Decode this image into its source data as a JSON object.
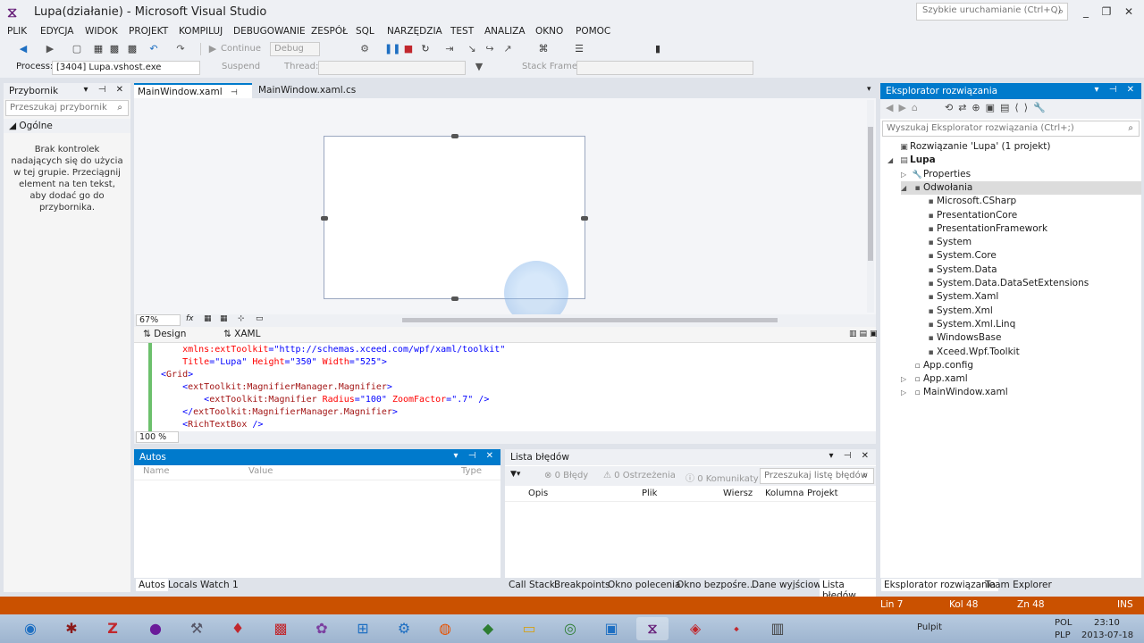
{
  "window": {
    "title": "Lupa(działanie) - Microsoft Visual Studio",
    "quick_launch_placeholder": "Szybkie uruchamianie (Ctrl+Q)",
    "logo_text": "⧖"
  },
  "menu": [
    "PLIK",
    "EDYCJA",
    "WIDOK",
    "PROJEKT",
    "KOMPILUJ",
    "DEBUGOWANIE",
    "ZESPÓŁ",
    "SQL",
    "NARZĘDZIA",
    "TEST",
    "ANALIZA",
    "OKNO",
    "POMOC"
  ],
  "toolbar": {
    "continue_label": "Continue",
    "config_value": "Debug",
    "process_label": "Process:",
    "process_value": "[3404] Lupa.vshost.exe",
    "suspend_label": "Suspend",
    "thread_label": "Thread:",
    "stack_frame_label": "Stack Frame:"
  },
  "toolbox": {
    "title": "Przybornik",
    "search_placeholder": "Przeszukaj przybornik",
    "group": "Ogólne",
    "message": "Brak kontrolek nadających się do użycia w tej grupie. Przeciągnij element na ten tekst, aby dodać go do przybornika."
  },
  "tabs": {
    "main_xaml": "MainWindow.xaml",
    "main_cs": "MainWindow.xaml.cs"
  },
  "designer": {
    "zoom": "67%",
    "tab_design": "Design",
    "tab_xaml": "XAML"
  },
  "code": {
    "zoom": "100 %",
    "lines": [
      {
        "indent": "    ",
        "parts": [
          {
            "t": "xmlns:extToolkit",
            "c": "attr"
          },
          {
            "t": "=",
            "c": "punc"
          },
          {
            "t": "\"http://schemas.xceed.com/wpf/xaml/toolkit\"",
            "c": "val"
          }
        ]
      },
      {
        "indent": "    ",
        "parts": [
          {
            "t": "Title",
            "c": "attr"
          },
          {
            "t": "=",
            "c": "punc"
          },
          {
            "t": "\"Lupa\"",
            "c": "val"
          },
          {
            "t": " Height",
            "c": "attr"
          },
          {
            "t": "=",
            "c": "punc"
          },
          {
            "t": "\"350\"",
            "c": "val"
          },
          {
            "t": " Width",
            "c": "attr"
          },
          {
            "t": "=",
            "c": "punc"
          },
          {
            "t": "\"525\"",
            "c": "val"
          },
          {
            "t": ">",
            "c": "punc"
          }
        ]
      },
      {
        "indent": "",
        "parts": [
          {
            "t": "<",
            "c": "punc"
          },
          {
            "t": "Grid",
            "c": "tag"
          },
          {
            "t": ">",
            "c": "punc"
          }
        ]
      },
      {
        "indent": "    ",
        "parts": [
          {
            "t": "<",
            "c": "punc"
          },
          {
            "t": "extToolkit:MagnifierManager.Magnifier",
            "c": "tag"
          },
          {
            "t": ">",
            "c": "punc"
          }
        ]
      },
      {
        "indent": "        ",
        "parts": [
          {
            "t": "<",
            "c": "punc"
          },
          {
            "t": "extToolkit:Magnifier",
            "c": "tag"
          },
          {
            "t": " Radius",
            "c": "attr"
          },
          {
            "t": "=",
            "c": "punc"
          },
          {
            "t": "\"100\"",
            "c": "val"
          },
          {
            "t": " ZoomFactor",
            "c": "attr"
          },
          {
            "t": "=",
            "c": "punc"
          },
          {
            "t": "\".7\"",
            "c": "val"
          },
          {
            "t": " />",
            "c": "punc"
          }
        ]
      },
      {
        "indent": "    ",
        "parts": [
          {
            "t": "</",
            "c": "punc"
          },
          {
            "t": "extToolkit:MagnifierManager.Magnifier",
            "c": "tag"
          },
          {
            "t": ">",
            "c": "punc"
          }
        ]
      },
      {
        "indent": "    ",
        "parts": [
          {
            "t": "<",
            "c": "punc"
          },
          {
            "t": "RichTextBox",
            "c": "tag"
          },
          {
            "t": " />",
            "c": "punc"
          }
        ]
      }
    ]
  },
  "autos": {
    "title": "Autos",
    "col_name": "Name",
    "col_value": "Value",
    "col_type": "Type",
    "tabs": [
      "Autos",
      "Locals",
      "Watch 1"
    ]
  },
  "errors": {
    "title": "Lista błędów",
    "errors_count": "0 Błędy",
    "warnings_count": "0 Ostrzeżenia",
    "messages_count": "0 Komunikaty",
    "search_placeholder": "Przeszukaj listę błędów",
    "columns": [
      "Opis",
      "Plik",
      "Wiersz",
      "Kolumna",
      "Projekt"
    ],
    "tabs": [
      "Call Stack",
      "Breakpoints",
      "Okno polecenia",
      "Okno bezpośre...",
      "Dane wyjściowe",
      "Lista błędów"
    ]
  },
  "solution": {
    "title": "Eksplorator rozwiązania",
    "search_placeholder": "Wyszukaj Eksplorator rozwiązania (Ctrl+;)",
    "items": [
      {
        "label": "Rozwiązanie 'Lupa' (1 projekt)",
        "level": 0,
        "arrow": "",
        "icon": "▣",
        "bold": false
      },
      {
        "label": "Lupa",
        "level": 0,
        "arrow": "◢",
        "icon": "▤",
        "bold": true
      },
      {
        "label": "Properties",
        "level": 1,
        "arrow": "▷",
        "icon": "🔧",
        "bold": false
      },
      {
        "label": "Odwołania",
        "level": 1,
        "arrow": "◢",
        "icon": "▪",
        "bold": false,
        "selected": true
      },
      {
        "label": "Microsoft.CSharp",
        "level": 2,
        "arrow": "",
        "icon": "▪",
        "bold": false
      },
      {
        "label": "PresentationCore",
        "level": 2,
        "arrow": "",
        "icon": "▪",
        "bold": false
      },
      {
        "label": "PresentationFramework",
        "level": 2,
        "arrow": "",
        "icon": "▪",
        "bold": false
      },
      {
        "label": "System",
        "level": 2,
        "arrow": "",
        "icon": "▪",
        "bold": false
      },
      {
        "label": "System.Core",
        "level": 2,
        "arrow": "",
        "icon": "▪",
        "bold": false
      },
      {
        "label": "System.Data",
        "level": 2,
        "arrow": "",
        "icon": "▪",
        "bold": false
      },
      {
        "label": "System.Data.DataSetExtensions",
        "level": 2,
        "arrow": "",
        "icon": "▪",
        "bold": false
      },
      {
        "label": "System.Xaml",
        "level": 2,
        "arrow": "",
        "icon": "▪",
        "bold": false
      },
      {
        "label": "System.Xml",
        "level": 2,
        "arrow": "",
        "icon": "▪",
        "bold": false
      },
      {
        "label": "System.Xml.Linq",
        "level": 2,
        "arrow": "",
        "icon": "▪",
        "bold": false
      },
      {
        "label": "WindowsBase",
        "level": 2,
        "arrow": "",
        "icon": "▪",
        "bold": false
      },
      {
        "label": "Xceed.Wpf.Toolkit",
        "level": 2,
        "arrow": "",
        "icon": "▪",
        "bold": false
      },
      {
        "label": "App.config",
        "level": 1,
        "arrow": "",
        "icon": "▫",
        "bold": false
      },
      {
        "label": "App.xaml",
        "level": 1,
        "arrow": "▷",
        "icon": "▫",
        "bold": false
      },
      {
        "label": "MainWindow.xaml",
        "level": 1,
        "arrow": "▷",
        "icon": "▫",
        "bold": false
      }
    ],
    "tabs": [
      "Eksplorator rozwiązania",
      "Team Explorer"
    ]
  },
  "status": {
    "line": "Lin 7",
    "column": "Kol 48",
    "char": "Zn 48",
    "mode": "INS"
  },
  "taskbar": {
    "desktop_label": "Pulpit",
    "lang": "POL",
    "layout": "PLP",
    "time": "23:10",
    "date": "2013-07-18"
  },
  "colors": {
    "accent": "#007acc",
    "status_bar": "#ca5100"
  }
}
